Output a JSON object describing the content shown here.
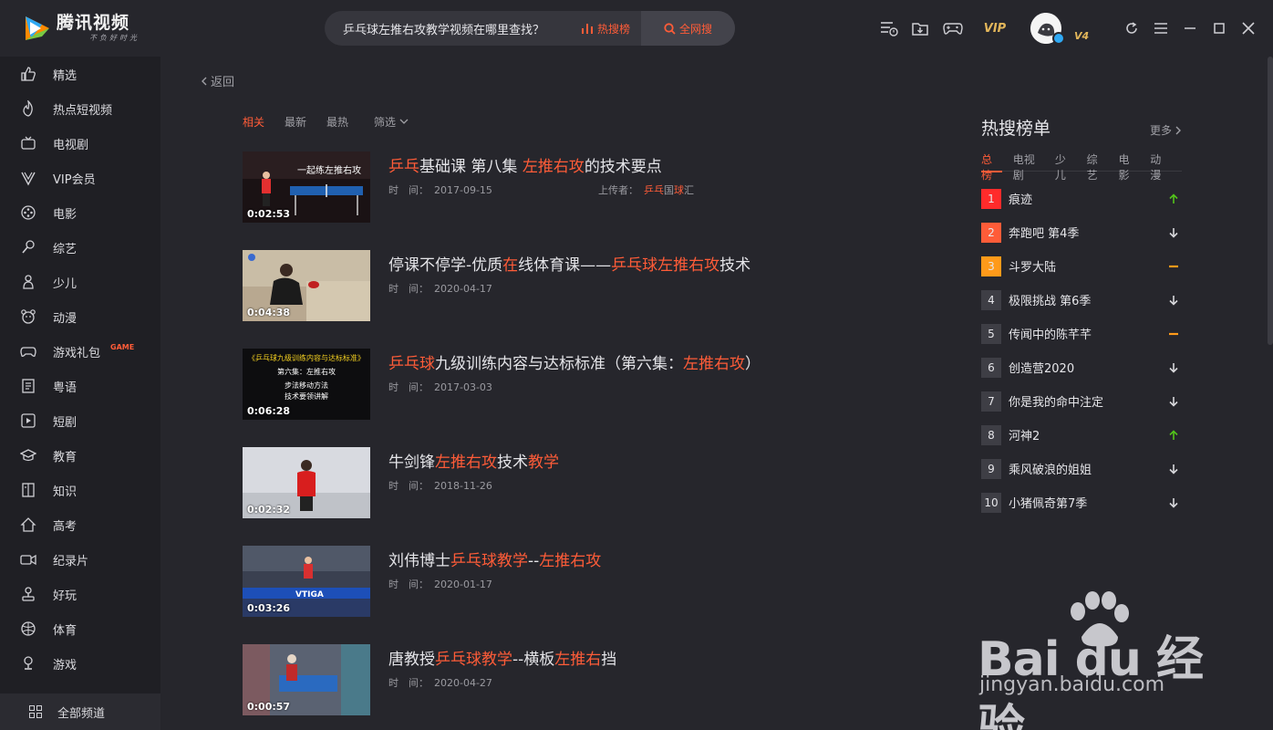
{
  "app": {
    "logo_name": "腾讯视频",
    "logo_slogan": "不负好时光"
  },
  "search": {
    "value": "乒乓球左推右攻教学视频在哪里查找？",
    "hotrank_label": "热搜榜",
    "allweb_label": "全网搜"
  },
  "header": {
    "vip_label": "VIP",
    "vlevel_label": "V4"
  },
  "sidebar": {
    "items": [
      {
        "label": "精选",
        "icon": "thumbs-up-icon"
      },
      {
        "label": "热点短视频",
        "icon": "flame-icon"
      },
      {
        "label": "电视剧",
        "icon": "tv-icon"
      },
      {
        "label": "VIP会员",
        "icon": "vip-icon"
      },
      {
        "label": "电影",
        "icon": "film-reel-icon"
      },
      {
        "label": "综艺",
        "icon": "microphone-icon"
      },
      {
        "label": "少儿",
        "icon": "kid-icon"
      },
      {
        "label": "动漫",
        "icon": "bear-face-icon"
      },
      {
        "label": "游戏礼包",
        "icon": "gamepad-icon",
        "badge": "GAME"
      },
      {
        "label": "粤语",
        "icon": "document-icon"
      },
      {
        "label": "短剧",
        "icon": "play-square-icon"
      },
      {
        "label": "教育",
        "icon": "graduation-cap-icon"
      },
      {
        "label": "知识",
        "icon": "book-icon"
      },
      {
        "label": "高考",
        "icon": "house-icon"
      },
      {
        "label": "纪录片",
        "icon": "camera-icon"
      },
      {
        "label": "好玩",
        "icon": "joystick-icon"
      },
      {
        "label": "体育",
        "icon": "ball-icon"
      },
      {
        "label": "游戏",
        "icon": "trophy-icon"
      }
    ],
    "all_channels": "全部频道"
  },
  "main": {
    "back_label": "返回",
    "filters": [
      "相关",
      "最新",
      "最热"
    ],
    "filter_more": "筛选",
    "time_label": "时　间：",
    "uploader_label": "上传者：",
    "results": [
      {
        "title_parts": [
          {
            "t": "乒乓",
            "hl": true
          },
          {
            "t": "基础课 第八集 ",
            "hl": false
          },
          {
            "t": "左推右攻",
            "hl": true
          },
          {
            "t": "的技术要点",
            "hl": false
          }
        ],
        "date": "2017-09-15",
        "duration": "0:02:53",
        "uploader_parts": [
          {
            "t": "乒乓",
            "hl": true
          },
          {
            "t": "国",
            "hl": false
          },
          {
            "t": "球",
            "hl": true
          },
          {
            "t": "汇",
            "hl": false
          }
        ],
        "thumb_caption": "一起练左推右攻"
      },
      {
        "title_parts": [
          {
            "t": "停课不停学-优质",
            "hl": false
          },
          {
            "t": "在",
            "hl": true
          },
          {
            "t": "线体育课——",
            "hl": false
          },
          {
            "t": "乒乓球左推右攻",
            "hl": true
          },
          {
            "t": "技术",
            "hl": false
          }
        ],
        "date": "2020-04-17",
        "duration": "0:04:38"
      },
      {
        "title_parts": [
          {
            "t": "乒乓球",
            "hl": true
          },
          {
            "t": "九级训练内容与达标标准（第六集：",
            "hl": false
          },
          {
            "t": "左推右攻",
            "hl": true
          },
          {
            "t": "）",
            "hl": false
          }
        ],
        "date": "2017-03-03",
        "duration": "0:06:28",
        "thumb_lines": [
          "《乒乓球九级训练内容与达标标准》",
          "第六集：左推右攻",
          "步法移动方法",
          "技术要领讲解"
        ]
      },
      {
        "title_parts": [
          {
            "t": "牛剑锋",
            "hl": false
          },
          {
            "t": "左推右攻",
            "hl": true
          },
          {
            "t": "技术",
            "hl": false
          },
          {
            "t": "教学",
            "hl": true
          }
        ],
        "date": "2018-11-26",
        "duration": "0:02:32"
      },
      {
        "title_parts": [
          {
            "t": "刘伟博士",
            "hl": false
          },
          {
            "t": "乒乓球教学",
            "hl": true
          },
          {
            "t": "--",
            "hl": false
          },
          {
            "t": "左推右攻",
            "hl": true
          }
        ],
        "date": "2020-01-17",
        "duration": "0:03:26",
        "thumb_brand": "VTIGA"
      },
      {
        "title_parts": [
          {
            "t": "唐教授",
            "hl": false
          },
          {
            "t": "乒乓球教学",
            "hl": true
          },
          {
            "t": "--横板",
            "hl": false
          },
          {
            "t": "左推右",
            "hl": true
          },
          {
            "t": "挡",
            "hl": false
          }
        ],
        "date": "2020-04-27",
        "duration": "0:00:57"
      }
    ]
  },
  "hot": {
    "title": "热搜榜单",
    "more_label": "更多",
    "tabs": [
      "总榜",
      "电视剧",
      "少儿",
      "综艺",
      "电影",
      "动漫"
    ],
    "items": [
      {
        "rank": "1",
        "name": "痕迹",
        "trend": "up"
      },
      {
        "rank": "2",
        "name": "奔跑吧 第4季",
        "trend": "down"
      },
      {
        "rank": "3",
        "name": "斗罗大陆",
        "trend": "flat"
      },
      {
        "rank": "4",
        "name": "极限挑战 第6季",
        "trend": "down"
      },
      {
        "rank": "5",
        "name": "传闻中的陈芊芊",
        "trend": "flat"
      },
      {
        "rank": "6",
        "name": "创造营2020",
        "trend": "down"
      },
      {
        "rank": "7",
        "name": "你是我的命中注定",
        "trend": "down"
      },
      {
        "rank": "8",
        "name": "河神2",
        "trend": "up"
      },
      {
        "rank": "9",
        "name": "乘风破浪的姐姐",
        "trend": "down"
      },
      {
        "rank": "10",
        "name": "小猪佩奇第7季",
        "trend": "down"
      }
    ],
    "colors": {
      "up": "#52c41a",
      "down": "#d8d8dc",
      "flat": "#ff9a1a"
    }
  },
  "watermark": {
    "text": "Bai du 经验",
    "url": "jingyan.baidu.com"
  }
}
